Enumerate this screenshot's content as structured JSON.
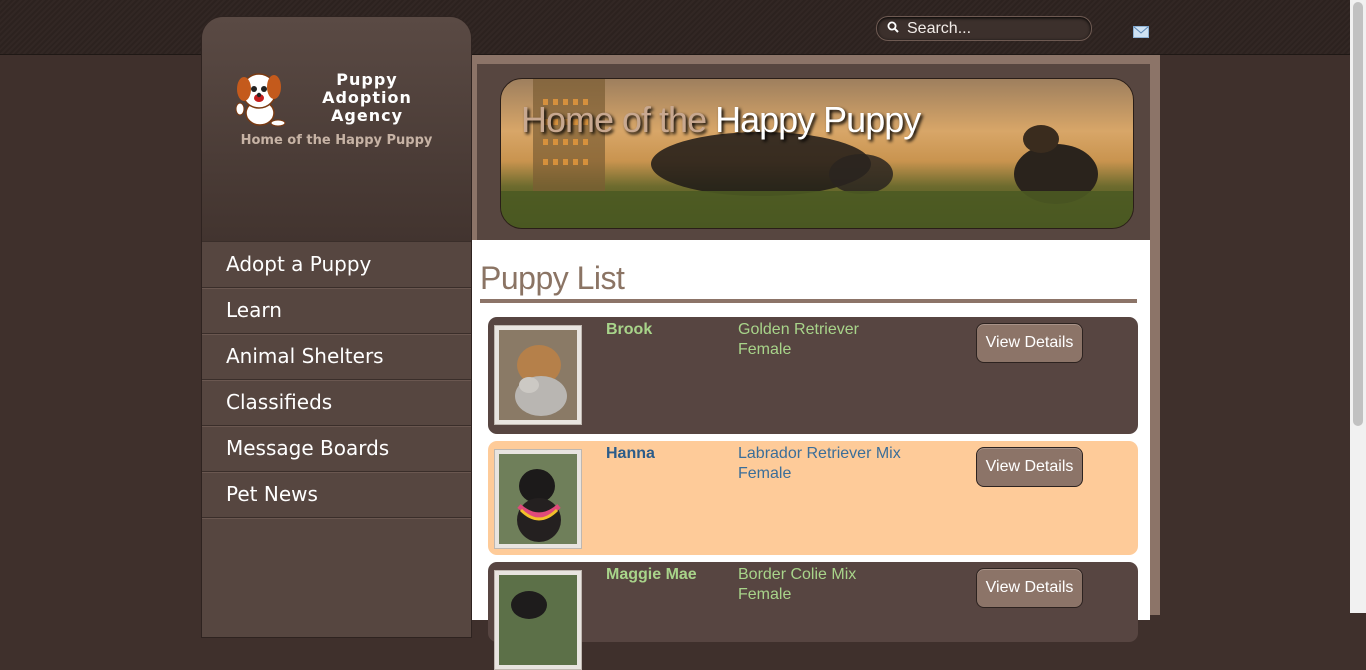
{
  "search": {
    "placeholder": "Search..."
  },
  "brand": {
    "name": "Puppy\nAdoption\nAgency",
    "tagline": "Home of the Happy Puppy"
  },
  "nav": {
    "items": [
      {
        "label": "Adopt a Puppy"
      },
      {
        "label": "Learn"
      },
      {
        "label": "Animal Shelters"
      },
      {
        "label": "Classifieds"
      },
      {
        "label": "Message Boards"
      },
      {
        "label": "Pet News"
      }
    ]
  },
  "banner": {
    "prefix": "Home of the ",
    "highlight": "Happy Puppy"
  },
  "page": {
    "title": "Puppy List"
  },
  "puppies": [
    {
      "name": "Brook",
      "breed": "Golden Retriever",
      "sex": "Female",
      "button": "View Details"
    },
    {
      "name": "Hanna",
      "breed": "Labrador Retriever Mix",
      "sex": "Female",
      "button": "View Details"
    },
    {
      "name": "Maggie Mae",
      "breed": "Border Colie Mix",
      "sex": "Female",
      "button": "View Details"
    }
  ],
  "colors": {
    "card_dark": "#574541",
    "card_light": "#fecb99",
    "accent": "#8c7468"
  },
  "icons": [
    "search-icon",
    "mail-icon",
    "puppy-logo-icon"
  ]
}
